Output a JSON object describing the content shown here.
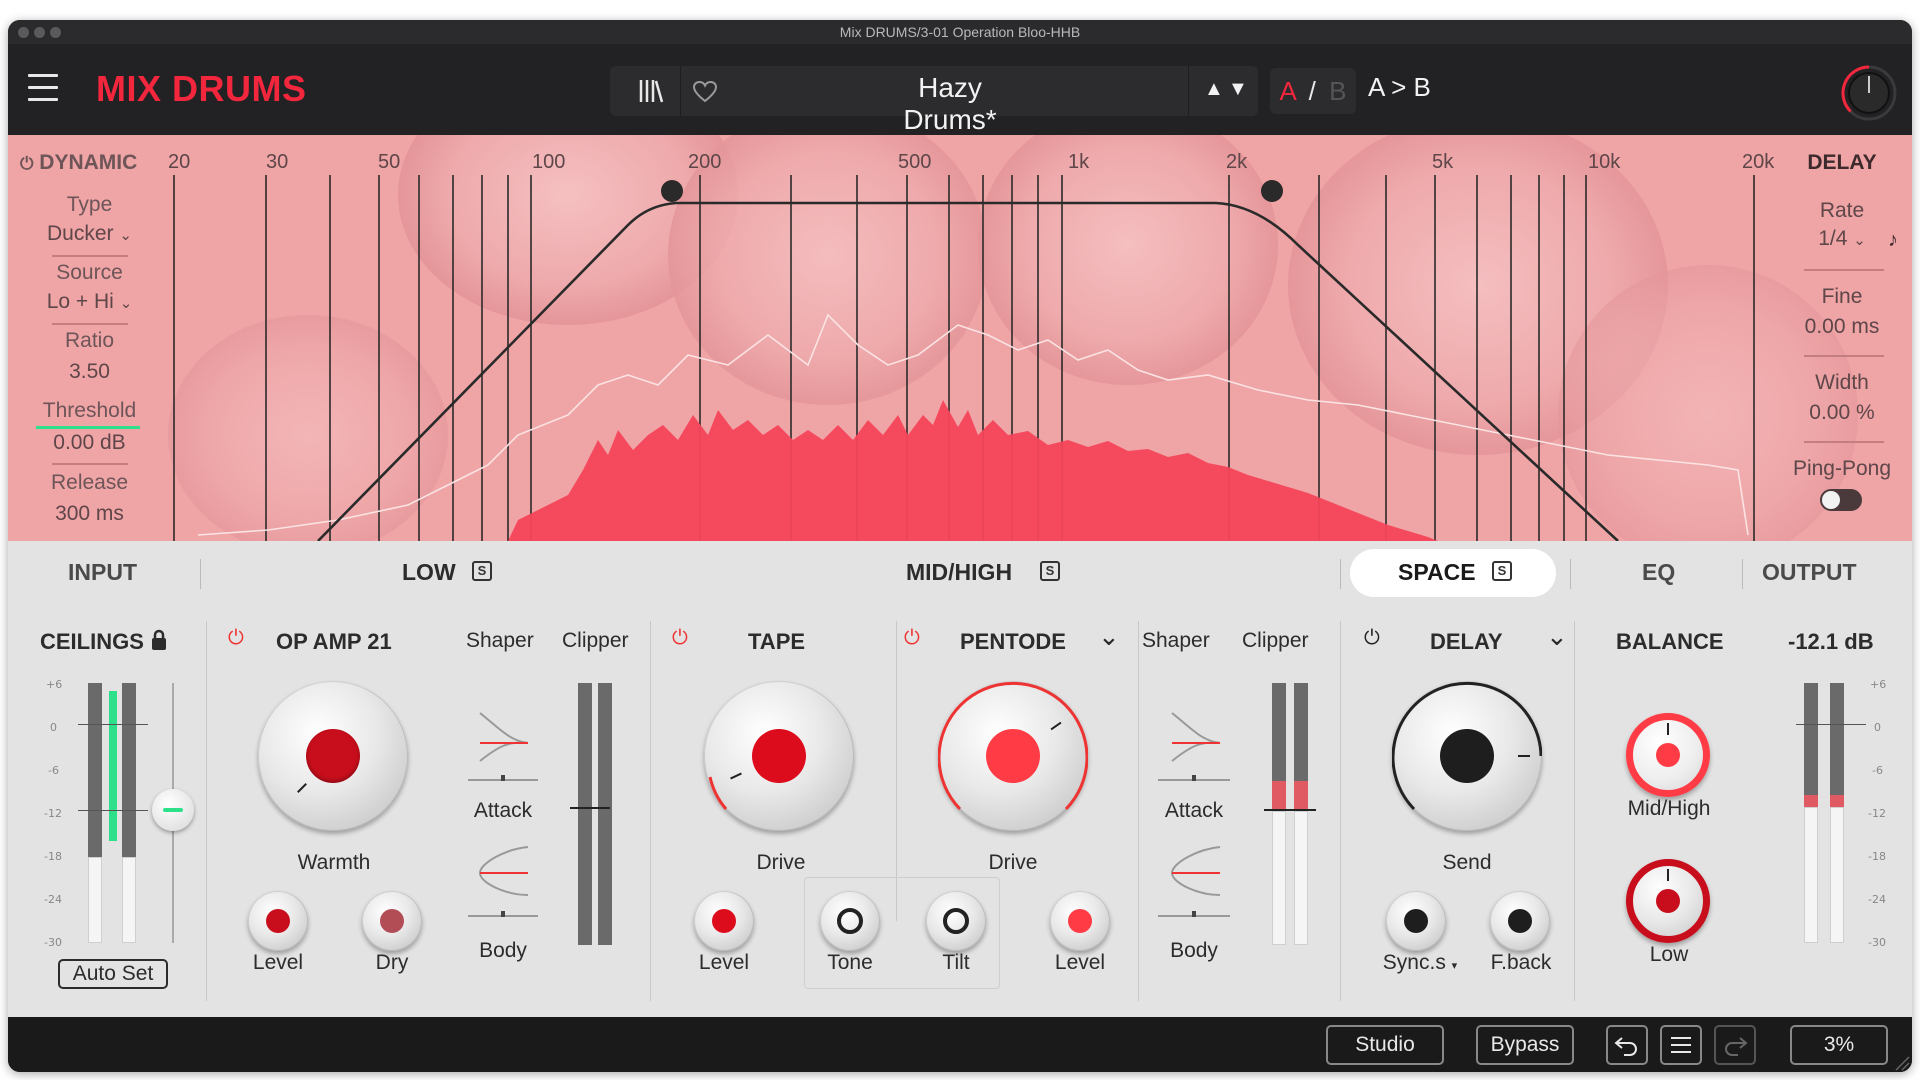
{
  "window": {
    "title": "Mix DRUMS/3-01 Operation Bloo-HHB"
  },
  "header": {
    "brand": "MIX DRUMS",
    "preset_name": "Hazy Drums*",
    "ab_a": "A",
    "ab_slash": "/",
    "ab_b": "B",
    "a_to_b": "A > B",
    "up_arrow": "▲",
    "down_arrow": "▼"
  },
  "spectrum": {
    "freq_labels": [
      "20",
      "30",
      "50",
      "100",
      "200",
      "500",
      "1k",
      "2k",
      "5k",
      "10k",
      "20k"
    ],
    "dynamic": {
      "title": "DYNAMIC",
      "type_label": "Type",
      "type_value": "Ducker",
      "source_label": "Source",
      "source_value": "Lo + Hi",
      "ratio_label": "Ratio",
      "ratio_value": "3.50",
      "threshold_label": "Threshold",
      "threshold_value": "0.00 dB",
      "release_label": "Release",
      "release_value": "300 ms"
    },
    "delay": {
      "title": "DELAY",
      "rate_label": "Rate",
      "rate_value": "1/4",
      "fine_label": "Fine",
      "fine_value": "0.00 ms",
      "width_label": "Width",
      "width_value": "0.00 %",
      "pingpong_label": "Ping-Pong"
    }
  },
  "tabs": {
    "input": "INPUT",
    "low": "LOW",
    "midhigh": "MID/HIGH",
    "space": "SPACE",
    "eq": "EQ",
    "output": "OUTPUT",
    "solo": "S"
  },
  "ceilings": {
    "title": "CEILINGS",
    "auto_set": "Auto Set",
    "scale": [
      "+6",
      "0",
      "-6",
      "-12",
      "-18",
      "-24",
      "-30"
    ]
  },
  "low": {
    "module": "OP AMP 21",
    "shaper": "Shaper",
    "clipper": "Clipper",
    "warmth": "Warmth",
    "level": "Level",
    "dry": "Dry",
    "attack": "Attack",
    "body": "Body"
  },
  "midhigh": {
    "tape": "TAPE",
    "pentode": "PENTODE",
    "shaper": "Shaper",
    "clipper": "Clipper",
    "tape_drive": "Drive",
    "pentode_drive": "Drive",
    "level_left": "Level",
    "level_right": "Level",
    "tone": "Tone",
    "tilt": "Tilt",
    "attack": "Attack",
    "body": "Body"
  },
  "space": {
    "module": "DELAY",
    "send": "Send",
    "sync": "Sync.s",
    "feedback": "F.back"
  },
  "output": {
    "balance": "BALANCE",
    "gain": "-12.1 dB",
    "midhigh": "Mid/High",
    "low": "Low",
    "scale": [
      "+6",
      "0",
      "-6",
      "-12",
      "-18",
      "-24",
      "-30"
    ]
  },
  "footer": {
    "studio": "Studio",
    "bypass": "Bypass",
    "zoom": "3%"
  },
  "colors": {
    "accent": "#f2263c",
    "spectrum_fill": "#f4465a",
    "meter_green": "#2ee08a"
  }
}
